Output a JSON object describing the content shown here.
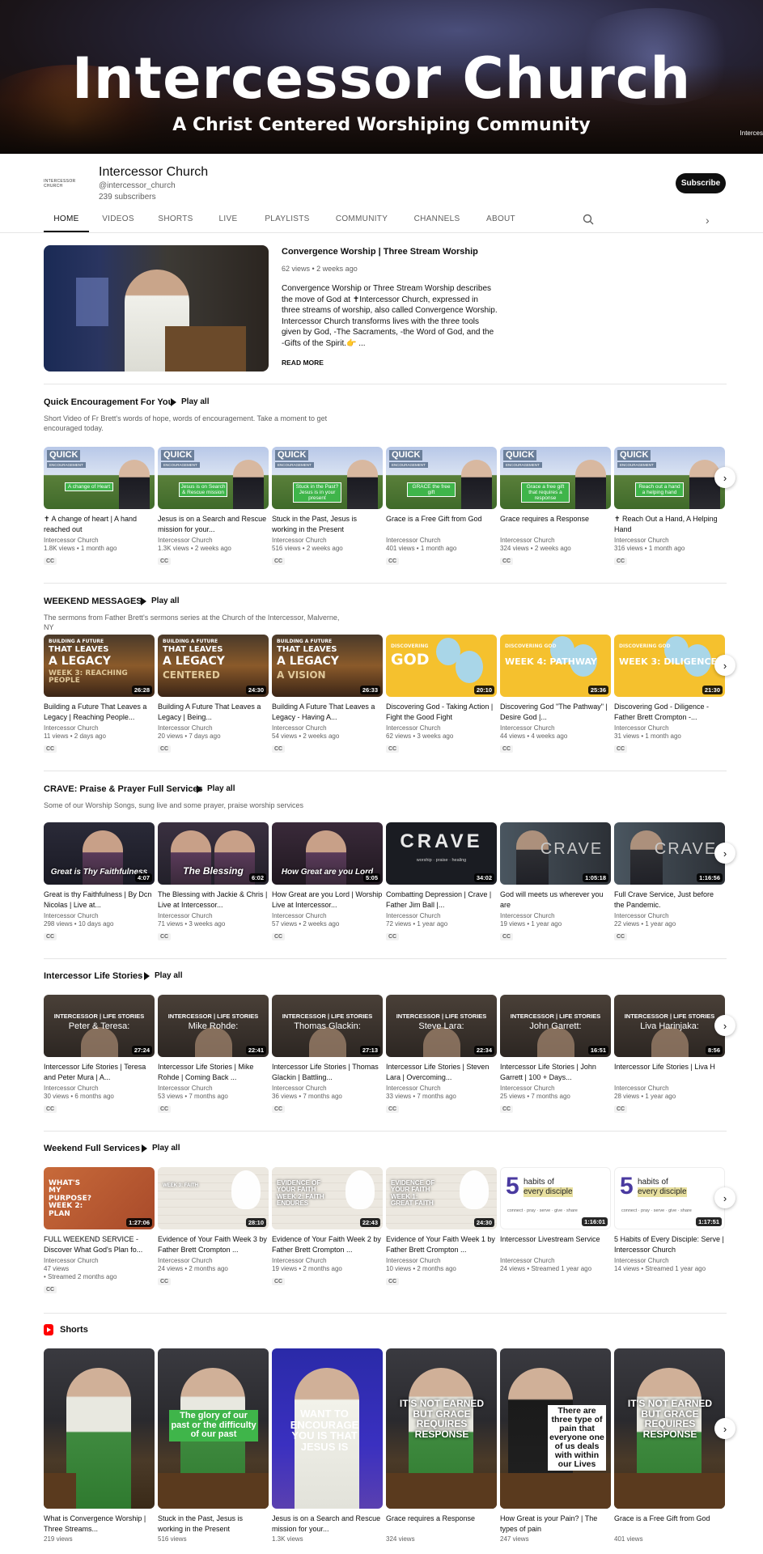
{
  "banner": {
    "title": "Intercessor Church",
    "subtitle": "A Christ Centered Worshiping Community",
    "corner": "Interces"
  },
  "channel": {
    "logo_text": "INTERCESSOR CHURCH",
    "name": "Intercessor Church",
    "handle": "@intercessor_church",
    "subscribers": "239 subscribers",
    "subscribe_label": "Subscribe"
  },
  "tabs": [
    "HOME",
    "VIDEOS",
    "SHORTS",
    "LIVE",
    "PLAYLISTS",
    "COMMUNITY",
    "CHANNELS",
    "ABOUT"
  ],
  "featured": {
    "title": "Convergence Worship | Three Stream Worship",
    "meta": "62 views • 2 weeks ago",
    "description": "Convergence Worship or Three Stream Worship describes the move of God at ✝Intercessor Church, expressed in three streams of worship, also called Convergence Worship. Intercessor Church transforms lives with the three tools given by God, -The Sacraments, -the Word of God, and the -Gifts of the Spirit.👉 ...",
    "read_more": "READ MORE"
  },
  "sections": [
    {
      "title": "Quick Encouragement For You",
      "play_all": "Play all",
      "description": "Short Video of Fr Brett's words of hope, words of encouragement. Take a moment to get encouraged today.",
      "videos": [
        {
          "title": "✝ A change of heart | A hand reached out",
          "channel": "Intercessor Church",
          "meta": "1.8K views • 1 month ago",
          "cc": "CC",
          "thumb_label": "QUICK",
          "thumb_sub": "ENCOURAGEMENT",
          "thumb_tag": "A change of Heart"
        },
        {
          "title": "Jesus is on a Search and Rescue mission for your...",
          "channel": "Intercessor Church",
          "meta": "1.3K views • 2 weeks ago",
          "cc": "CC",
          "thumb_label": "QUICK",
          "thumb_sub": "ENCOURAGEMENT",
          "thumb_tag": "Jesus is on Search & Rescue mission"
        },
        {
          "title": "Stuck in the Past, Jesus is working in the Present",
          "channel": "Intercessor Church",
          "meta": "516 views • 2 weeks ago",
          "cc": "CC",
          "thumb_label": "QUICK",
          "thumb_sub": "ENCOURAGEMENT",
          "thumb_tag": "Stuck in the Past? Jesus is in your present"
        },
        {
          "title": "Grace is a Free Gift from God",
          "channel": "Intercessor Church",
          "meta": "401 views • 1 month ago",
          "cc": "CC",
          "thumb_label": "QUICK",
          "thumb_sub": "ENCOURAGEMENT",
          "thumb_tag": "GRACE the free gift"
        },
        {
          "title": "Grace requires a Response",
          "channel": "Intercessor Church",
          "meta": "324 views • 2 weeks ago",
          "cc": "CC",
          "thumb_label": "QUICK",
          "thumb_sub": "ENCOURAGEMENT",
          "thumb_tag": "Grace a free gift that requires a response"
        },
        {
          "title": "✝ Reach Out a Hand, A Helping Hand",
          "channel": "Intercessor Church",
          "meta": "316 views • 1 month ago",
          "cc": "CC",
          "thumb_label": "QUICK",
          "thumb_sub": "ENCOURAGEMENT",
          "thumb_tag": "Reach out a hand a helping hand"
        }
      ]
    },
    {
      "title": "WEEKEND MESSAGES",
      "play_all": "Play all",
      "description": "The sermons from Father Brett's sermons series at the Church of the Intercessor, Malverne, NY",
      "videos": [
        {
          "title": "Building a Future That Leaves a Legacy | Reaching People...",
          "channel": "Intercessor Church",
          "meta": "11 views • 2 days ago",
          "cc": "CC",
          "duration": "26:28",
          "t1": "BUILDING A FUTURE",
          "t2": "THAT LEAVES",
          "t3": "A LEGACY",
          "t4": "WEEK 3: REACHING PEOPLE"
        },
        {
          "title": "Building A Future That Leaves a Legacy | Being...",
          "channel": "Intercessor Church",
          "meta": "20 views • 7 days ago",
          "cc": "CC",
          "duration": "24:30",
          "t1": "BUILDING A FUTURE",
          "t2": "THAT LEAVES",
          "t3": "A LEGACY",
          "t4": "CENTERED"
        },
        {
          "title": "Building A Future That Leaves a Legacy - Having A...",
          "channel": "Intercessor Church",
          "meta": "54 views • 2 weeks ago",
          "cc": "CC",
          "duration": "26:33",
          "t1": "BUILDING A FUTURE",
          "t2": "THAT LEAVES",
          "t3": "A LEGACY",
          "t4": "A VISION"
        },
        {
          "title": "Discovering God - Taking Action | Fight the Good Fight",
          "channel": "Intercessor Church",
          "meta": "62 views • 3 weeks ago",
          "cc": "CC",
          "duration": "20:10",
          "y1": "DISCOVERING",
          "y2": "GOD"
        },
        {
          "title": "Discovering God \"The Pathway\" | Desire God |...",
          "channel": "Intercessor Church",
          "meta": "44 views • 4 weeks ago",
          "cc": "CC",
          "duration": "25:36",
          "y1": "DISCOVERING GOD",
          "y2": "WEEK 4: PATHWAY"
        },
        {
          "title": "Discovering God - Diligence - Father Brett Crompton -...",
          "channel": "Intercessor Church",
          "meta": "31 views • 1 month ago",
          "cc": "CC",
          "duration": "21:30",
          "y1": "DISCOVERING GOD",
          "y2": "WEEK 3: DILIGENCE"
        }
      ]
    },
    {
      "title": "CRAVE: Praise & Prayer Full Services",
      "play_all": "Play all",
      "description": "Some of our Worship Songs, sung live and some prayer, praise worship services",
      "videos": [
        {
          "title": "Great is thy Faithfulness | By Dcn Nicolas | Live at...",
          "channel": "Intercessor Church",
          "meta": "298 views • 10 days ago",
          "cc": "CC",
          "duration": "4:07",
          "script": "Great is Thy Faithfulness"
        },
        {
          "title": "The Blessing with Jackie & Chris | Live at Intercessor...",
          "channel": "Intercessor Church",
          "meta": "71 views • 3 weeks ago",
          "cc": "CC",
          "duration": "6:02",
          "script": "The Blessing"
        },
        {
          "title": "How Great are you Lord | Worship Live at Intercessor...",
          "channel": "Intercessor Church",
          "meta": "57 views • 2 weeks ago",
          "cc": "CC",
          "duration": "5:05",
          "script": "How Great are you Lord"
        },
        {
          "title": "Combatting Depression | Crave | Father Jim Ball |...",
          "channel": "Intercessor Church",
          "meta": "72 views • 1 year ago",
          "cc": "CC",
          "duration": "34:02",
          "big": "CRAVE",
          "small": "worship · praise · healing"
        },
        {
          "title": "God will meets us wherever you are",
          "channel": "Intercessor Church",
          "meta": "19 views • 1 year ago",
          "cc": "CC",
          "duration": "1:05:18",
          "big": "CRAVE"
        },
        {
          "title": "Full Crave Service, Just before the Pandemic.",
          "channel": "Intercessor Church",
          "meta": "22 views • 1 year ago",
          "cc": "CC",
          "duration": "1:16:56",
          "big": "CRAVE"
        }
      ]
    },
    {
      "title": "Intercessor Life Stories",
      "play_all": "Play all",
      "description": "",
      "videos": [
        {
          "title": "Intercessor Life Stories | Teresa and Peter Mura | A...",
          "channel": "Intercessor Church",
          "meta": "30 views • 6 months ago",
          "cc": "CC",
          "duration": "27:24",
          "lt1": "INTERCESSOR | LIFE STORIES",
          "lt2": "Peter & Teresa:"
        },
        {
          "title": "Intercessor Life Stories | Mike Rohde | Coming Back ...",
          "channel": "Intercessor Church",
          "meta": "53 views • 7 months ago",
          "cc": "CC",
          "duration": "22:41",
          "lt1": "INTERCESSOR | LIFE STORIES",
          "lt2": "Mike Rohde:"
        },
        {
          "title": "Intercessor Life Stories | Thomas Glackin | Battling...",
          "channel": "Intercessor Church",
          "meta": "36 views • 7 months ago",
          "cc": "CC",
          "duration": "27:13",
          "lt1": "INTERCESSOR | LIFE STORIES",
          "lt2": "Thomas Glackin:"
        },
        {
          "title": "Intercessor Life Stories | Steven Lara | Overcoming...",
          "channel": "Intercessor Church",
          "meta": "33 views • 7 months ago",
          "cc": "CC",
          "duration": "22:34",
          "lt1": "INTERCESSOR | LIFE STORIES",
          "lt2": "Steve Lara:"
        },
        {
          "title": "Intercessor Life Stories | John Garrett | 100 + Days...",
          "channel": "Intercessor Church",
          "meta": "25 views • 7 months ago",
          "cc": "CC",
          "duration": "16:51",
          "lt1": "INTERCESSOR | LIFE STORIES",
          "lt2": "John Garrett:"
        },
        {
          "title": "Intercessor Life Stories | Liva H",
          "channel": "Intercessor Church",
          "meta": "28 views • 1 year ago",
          "cc": "CC",
          "duration": "8:56",
          "lt1": "INTERCESSOR | LIFE STORIES",
          "lt2": "Liva Harinjaka:"
        }
      ]
    },
    {
      "title": "Weekend Full Services",
      "play_all": "Play all",
      "description": "",
      "videos": [
        {
          "title": "FULL WEEKEND SERVICE - Discover What God's Plan fo...",
          "channel": "Intercessor Church",
          "meta": "47 views",
          "meta2": "• Streamed 2 months ago",
          "cc": "CC",
          "duration": "1:27:06",
          "ol": "WHAT'S MY PURPOSE? WEEK 2: PLAN"
        },
        {
          "title": "Evidence of Your Faith Week 3 by Father Brett Crompton ...",
          "channel": "Intercessor Church",
          "meta": "24 views • 2 months ago",
          "cc": "CC",
          "duration": "28:10",
          "ol": "WEEK 3: FAITH"
        },
        {
          "title": "Evidence of Your Faith Week 2 by Father Brett Crompton ...",
          "channel": "Intercessor Church",
          "meta": "19 views • 2 months ago",
          "cc": "CC",
          "duration": "22:43",
          "ol": "EVIDENCE OF YOUR FAITH WEEK 2: FAITH ENDURES"
        },
        {
          "title": "Evidence of Your Faith Week 1 by Father Brett Crompton ...",
          "channel": "Intercessor Church",
          "meta": "10 views • 2 months ago",
          "cc": "CC",
          "duration": "24:30",
          "ol": "EVIDENCE OF YOUR FAITH WEEK 1: GREAT FAITH"
        },
        {
          "title": "Intercessor Livestream Service",
          "channel": "Intercessor Church",
          "meta": "24 views • Streamed 1 year ago",
          "cc": "",
          "duration": "1:16:01",
          "num": "5",
          "l1": "habits of",
          "l2": "every disciple",
          "sub": "connect · pray · serve · give · share"
        },
        {
          "title": "5 Habits of Every Disciple: Serve | Intercessor Church",
          "channel": "Intercessor Church",
          "meta": "14 views • Streamed 1 year ago",
          "cc": "",
          "duration": "1:17:51",
          "num": "5",
          "l1": "habits of",
          "l2": "every disciple",
          "sub": "connect · pray · serve · give · share"
        }
      ]
    }
  ],
  "shorts": {
    "title": "Shorts",
    "items": [
      {
        "title": "What is Convergence Worship | Three Streams...",
        "views": "219 views",
        "caption": ""
      },
      {
        "title": "Stuck in the Past, Jesus is working in the Present",
        "views": "516 views",
        "caption": "The glory of our past or the difficulty of our past"
      },
      {
        "title": "Jesus is on a Search and Rescue mission for your...",
        "views": "1.3K views",
        "caption": "WANT TO ENCOURAGE YOU IS THAT JESUS IS"
      },
      {
        "title": "Grace requires a Response",
        "views": "324 views",
        "caption": "IT'S NOT EARNED BUT GRACE REQUIRES RESPONSE"
      },
      {
        "title": "How Great is your Pain? | The types of pain",
        "views": "247 views",
        "caption": "There are three type of pain that everyone one of us deals with within our Lives"
      },
      {
        "title": "Grace is a Free Gift from God",
        "views": "401 views",
        "caption": "IT'S NOT EARNED BUT GRACE REQUIRES RESPONSE"
      }
    ]
  }
}
